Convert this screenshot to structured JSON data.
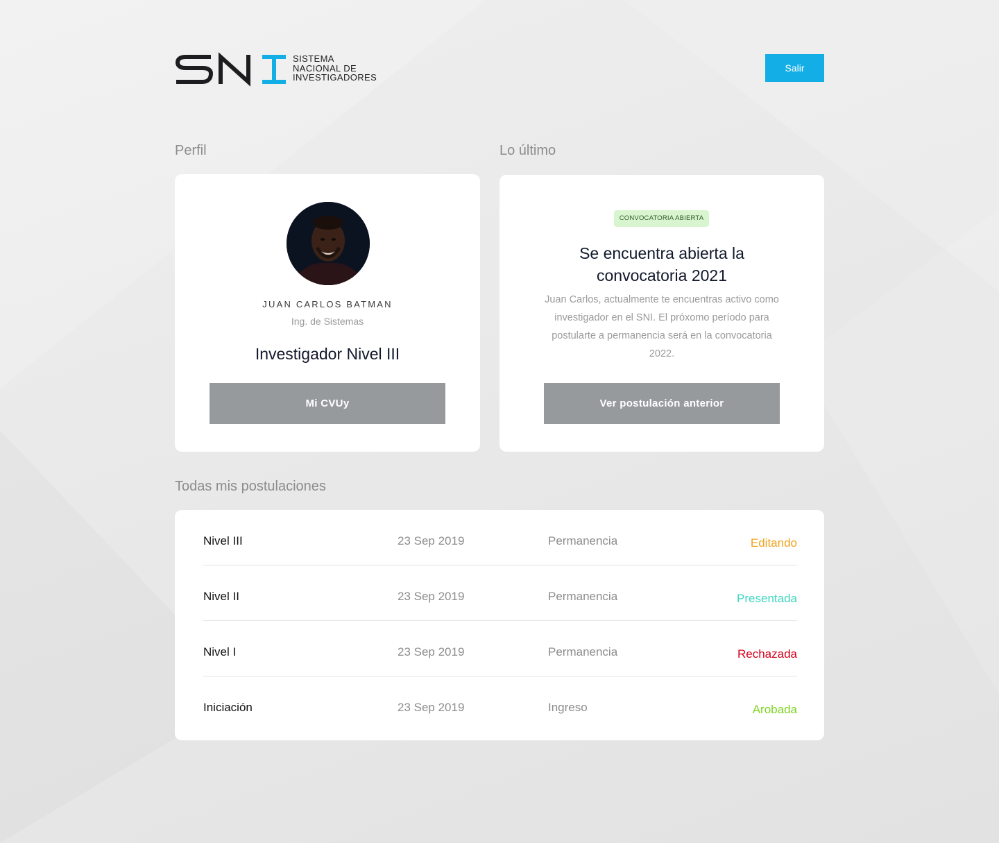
{
  "header": {
    "logo_mark": "SNI",
    "logo_lines": [
      "SISTEMA",
      "NACIONAL DE",
      "INVESTIGADORES"
    ],
    "logout_label": "Salir"
  },
  "profile": {
    "section_title": "Perfil",
    "name": "JUAN CARLOS BATMAN",
    "title": "Ing. de Sistemas",
    "level": "Investigador Nivel III",
    "button_label": "Mi CVUy"
  },
  "latest": {
    "section_title": "Lo último",
    "badge": "CONVOCATORIA ABIERTA",
    "headline_line1": "Se encuentra abierta la",
    "headline_line2": "convocatoria 2021",
    "body": "Juan Carlos, actualmente te encuentras activo como investigador en el SNI. El próxomo período para postularte a permanencia será en la convocatoria 2022.",
    "button_label": "Ver postulación anterior"
  },
  "applications": {
    "section_title": "Todas mis postulaciones",
    "rows": [
      {
        "level": "Nivel III",
        "date": "23 Sep 2019",
        "type": "Permanencia",
        "status": "Editando",
        "status_color": "#f0a21c"
      },
      {
        "level": "Nivel II",
        "date": "23 Sep 2019",
        "type": "Permanencia",
        "status": "Presentada",
        "status_color": "#3fd6c0"
      },
      {
        "level": "Nivel I",
        "date": "23 Sep 2019",
        "type": "Permanencia",
        "status": "Rechazada",
        "status_color": "#d4001a"
      },
      {
        "level": "Iniciación",
        "date": "23 Sep 2019",
        "type": "Ingreso",
        "status": "Arobada",
        "status_color": "#7ed321"
      }
    ]
  },
  "colors": {
    "accent": "#14aee6",
    "button_grey": "#979a9d",
    "badge_bg": "#d9f5cf"
  }
}
